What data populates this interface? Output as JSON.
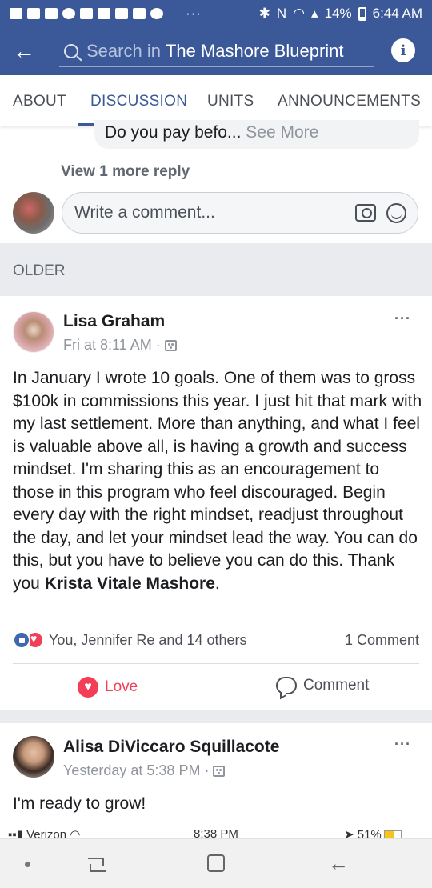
{
  "status_bar": {
    "dots": "···",
    "battery": "14%",
    "time": "6:44 AM"
  },
  "header": {
    "search_prefix": "Search in",
    "group_name": "The Mashore Blueprint"
  },
  "tabs": [
    {
      "label": "ABOUT"
    },
    {
      "label": "DISCUSSION",
      "active": true
    },
    {
      "label": "UNITS"
    },
    {
      "label": "ANNOUNCEMENTS"
    }
  ],
  "comment_thread": {
    "reply_text": "Do you pay befo...",
    "see_more": "See More",
    "view_more_replies": "View 1 more reply",
    "write_comment_placeholder": "Write a comment..."
  },
  "older_label": "OLDER",
  "posts": [
    {
      "author": "Lisa Graham",
      "time": "Fri at 8:11 AM",
      "body": "In January I wrote 10 goals. One of them was to gross $100k in commissions this year. I just hit that mark with my last settlement. More than anything, and what I feel is valuable above all, is having a growth and success mindset. I'm sharing this as an encouragement to those in this program who feel discouraged. Begin every day with the right mindset, readjust throughout the day, and let your mindset lead the way. You can do this, but you have to believe you can do this. Thank you",
      "mention": "Krista Vitale Mashore",
      "mention_suffix": ".",
      "reactions_label": "You, Jennifer Re and 14 others",
      "comment_count": "1 Comment",
      "love_label": "Love",
      "comment_label": "Comment"
    },
    {
      "author": "Alisa DiViccaro Squillacote",
      "time": "Yesterday at 5:38 PM",
      "body": "I'm ready to grow!"
    }
  ],
  "embedded_status": {
    "carrier": "Verizon",
    "time": "8:38 PM",
    "battery": "51%"
  },
  "colors": {
    "brand_blue": "#3b5998",
    "love_red": "#f33e58",
    "like_blue": "#4267b2"
  }
}
